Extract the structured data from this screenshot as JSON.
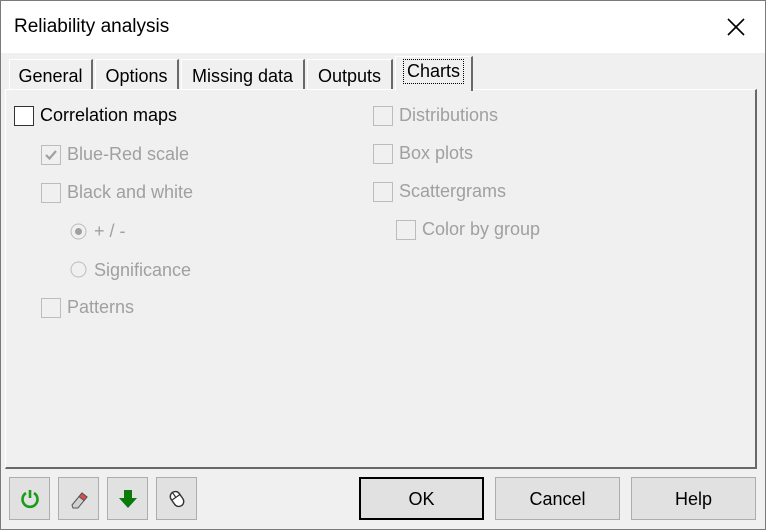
{
  "window": {
    "title": "Reliability analysis"
  },
  "tabs": [
    {
      "label": "General"
    },
    {
      "label": "Options"
    },
    {
      "label": "Missing data"
    },
    {
      "label": "Outputs"
    },
    {
      "label": "Charts"
    }
  ],
  "charts": {
    "correlation_maps": {
      "label": "Correlation maps",
      "checked": false,
      "enabled": true
    },
    "blue_red_scale": {
      "label": "Blue-Red scale",
      "checked": true,
      "enabled": false
    },
    "black_and_white": {
      "label": "Black and white",
      "checked": false,
      "enabled": false
    },
    "plus_minus": {
      "label": "+ / -",
      "selected": true,
      "enabled": false
    },
    "significance": {
      "label": "Significance",
      "selected": false,
      "enabled": false
    },
    "patterns": {
      "label": "Patterns",
      "checked": false,
      "enabled": false
    },
    "distributions": {
      "label": "Distributions",
      "checked": false,
      "enabled": false
    },
    "box_plots": {
      "label": "Box plots",
      "checked": false,
      "enabled": false
    },
    "scattergrams": {
      "label": "Scattergrams",
      "checked": false,
      "enabled": false
    },
    "color_by_group": {
      "label": "Color by group",
      "checked": false,
      "enabled": false
    }
  },
  "toolbar": {
    "icons": [
      "reset-icon",
      "eraser-icon",
      "download-arrow-icon",
      "mouse-icon"
    ]
  },
  "buttons": {
    "ok": "OK",
    "cancel": "Cancel",
    "help": "Help"
  },
  "colors": {
    "reset_green": "#1a9c1a",
    "arrow_green": "#0b7a0b",
    "disabled_text": "#a0a0a0"
  }
}
